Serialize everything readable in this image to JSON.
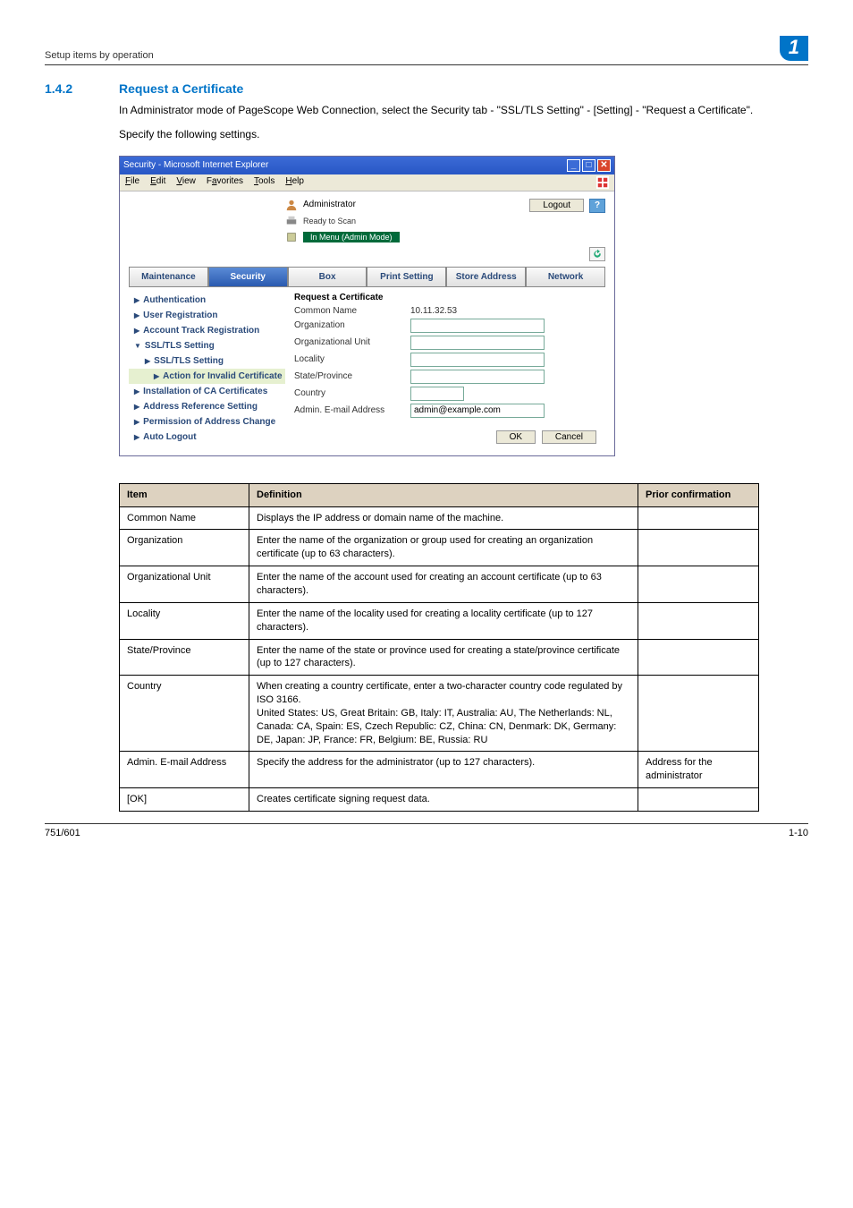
{
  "running_head": "Setup items by operation",
  "chapter_number": "1",
  "section": {
    "num": "1.4.2",
    "title": "Request a Certificate"
  },
  "intro_para": "In Administrator mode of PageScope Web Connection, select the Security tab - \"SSL/TLS Setting\" - [Setting] - \"Request a Certificate\".",
  "specify_line": "Specify the following settings.",
  "screenshot": {
    "window_title": "Security - Microsoft Internet Explorer",
    "menu": {
      "file": "File",
      "edit": "Edit",
      "view": "View",
      "favorites": "Favorites",
      "tools": "Tools",
      "help": "Help"
    },
    "admin_label": "Administrator",
    "ready_label": "Ready to Scan",
    "mode_label": "In Menu (Admin Mode)",
    "logout": "Logout",
    "help": "?",
    "tabs": {
      "maintenance": "Maintenance",
      "security": "Security",
      "box": "Box",
      "print": "Print Setting",
      "store": "Store Address",
      "network": "Network"
    },
    "sidebar": {
      "auth": "Authentication",
      "userreg": "User Registration",
      "acct": "Account Track Registration",
      "ssl": "SSL/TLS Setting",
      "ssl_child": "SSL/TLS Setting",
      "action_invalid": "Action for Invalid Certificate",
      "ca": "Installation of CA Certificates",
      "addr_ref": "Address Reference Setting",
      "perm_addr": "Permission of Address Change",
      "auto_logout": "Auto Logout"
    },
    "form": {
      "title": "Request a Certificate",
      "common_name_label": "Common Name",
      "common_name_value": "10.11.32.53",
      "org_label": "Organization",
      "orgunit_label": "Organizational Unit",
      "locality_label": "Locality",
      "state_label": "State/Province",
      "country_label": "Country",
      "email_label": "Admin. E-mail Address",
      "email_value": "admin@example.com",
      "ok": "OK",
      "cancel": "Cancel"
    }
  },
  "table": {
    "head": {
      "item": "Item",
      "definition": "Definition",
      "prior": "Prior confirmation"
    },
    "rows": [
      {
        "item": "Common Name",
        "def": "Displays the IP address or domain name of the machine.",
        "prior": ""
      },
      {
        "item": "Organization",
        "def": "Enter the name of the organization or group used for creating an organization certificate (up to 63 characters).",
        "prior": ""
      },
      {
        "item": "Organizational Unit",
        "def": "Enter the name of the account used for creating an account certificate (up to 63 characters).",
        "prior": ""
      },
      {
        "item": "Locality",
        "def": "Enter the name of the locality used for creating a locality certificate (up to 127 characters).",
        "prior": ""
      },
      {
        "item": "State/Province",
        "def": "Enter the name of the state or province used for creating a state/province certificate (up to 127 characters).",
        "prior": ""
      },
      {
        "item": "Country",
        "def": "When creating a country certificate, enter a two-character country code regulated by ISO 3166.\nUnited States: US, Great Britain: GB, Italy: IT, Australia: AU, The Netherlands: NL, Canada: CA, Spain: ES, Czech Republic: CZ, China: CN, Denmark: DK, Germany: DE, Japan: JP, France: FR, Belgium: BE, Russia: RU",
        "prior": ""
      },
      {
        "item": "Admin. E-mail Address",
        "def": "Specify the address for the administrator (up to 127 characters).",
        "prior": "Address for the administrator"
      },
      {
        "item": "[OK]",
        "def": "Creates certificate signing request data.",
        "prior": ""
      }
    ]
  },
  "footer": {
    "left": "751/601",
    "right": "1-10"
  }
}
